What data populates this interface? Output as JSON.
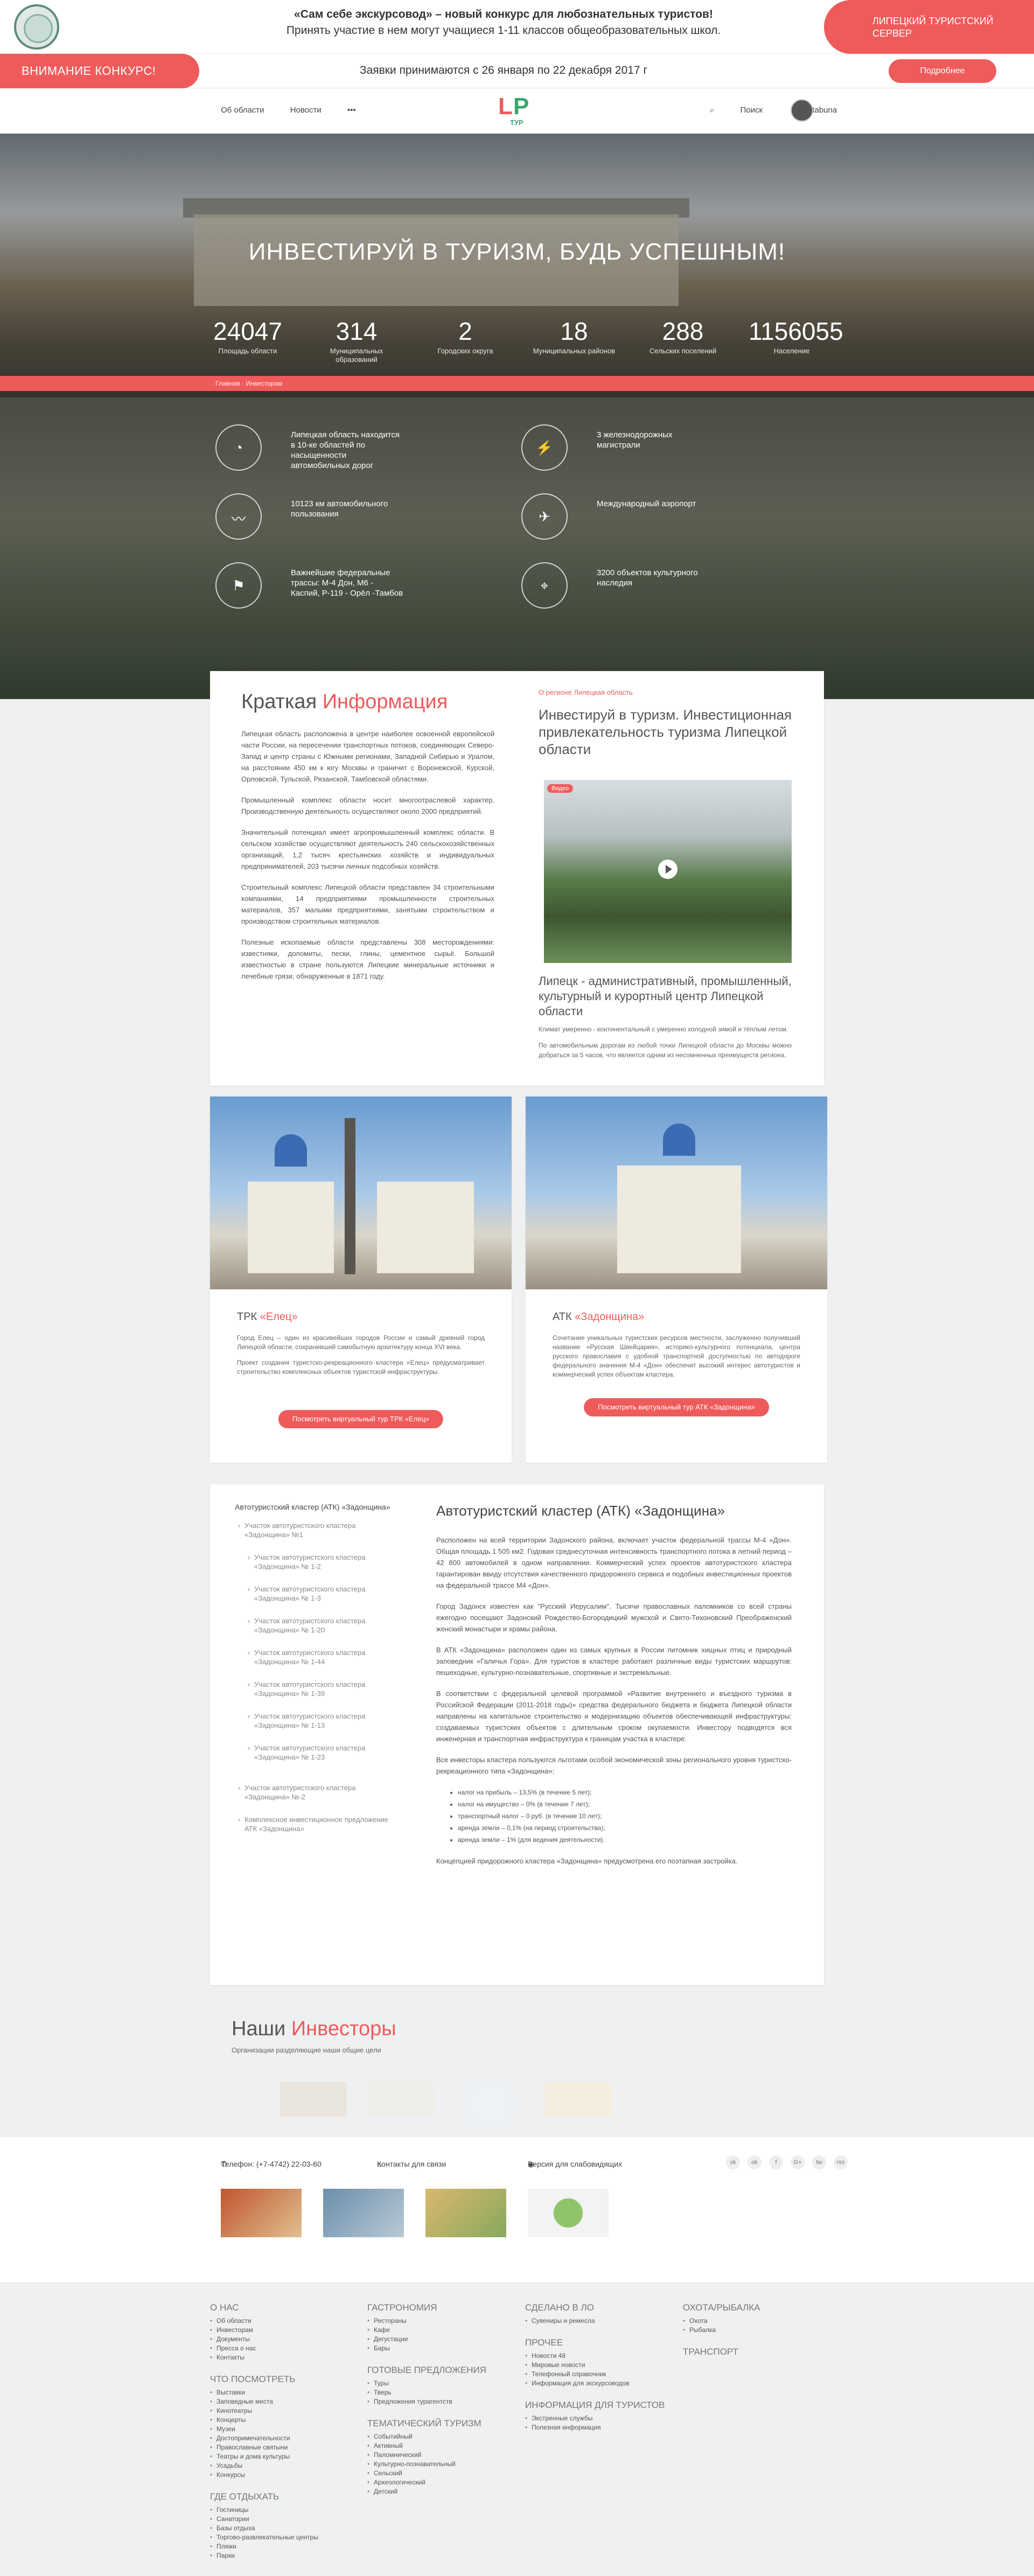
{
  "topbar": {
    "line1": "«Сам себе экскурсовод» – новый конкурс для любознательных туристов!",
    "line2": "Принять участие в нем могут учащиеся 1-11 классов общеобразовательных школ.",
    "server": "ЛИПЕЦКИЙ ТУРИСТСКИЙ СЕРВЕР"
  },
  "attention": {
    "label": "ВНИМАНИЕ КОНКУРС!",
    "text": "Заявки принимаются с 26 января по 22 декабря 2017 г",
    "button": "Подробнее"
  },
  "nav": {
    "links": [
      "Об области",
      "Новости",
      "•••"
    ],
    "search": "Поиск",
    "user": "tabuna",
    "brand": {
      "l": "L",
      "p": "P",
      "t": "ТУР"
    }
  },
  "hero": {
    "title": "ИНВЕСТИРУЙ В ТУРИЗМ, БУДЬ УСПЕШНЫМ!",
    "stats": [
      {
        "value": "24047",
        "label": "Площадь области"
      },
      {
        "value": "314",
        "label": "Муниципальных образований"
      },
      {
        "value": "2",
        "label": "Городских округа"
      },
      {
        "value": "18",
        "label": "Муниципальных районов"
      },
      {
        "value": "288",
        "label": "Сельских поселений"
      },
      {
        "value": "1156055",
        "label": "Население"
      }
    ],
    "breadcrumb": "Главная · Инвесторам"
  },
  "features": [
    {
      "icon": "◔",
      "text": "Липецкая область находится в 10-ке областей по насыщенности автомобильных дорог"
    },
    {
      "icon": "⚡",
      "text": "3 железнодорожных магистрали"
    },
    {
      "icon": "〰",
      "text": "10123 км автомобильного пользования"
    },
    {
      "icon": "✈",
      "text": "Международный аэропорт"
    },
    {
      "icon": "⚑",
      "text": "Важнейшие федеральные трассы: М-4 Дон, М6 - Каспий, Р-119 - Орёл -Тамбов"
    },
    {
      "icon": "⌖",
      "text": "3200 объектов культурного наследия"
    }
  ],
  "info": {
    "title_a": "Краткая ",
    "title_b": "Информация",
    "paragraphs": [
      "Липецкая область расположена в центре наиболее освоенной европейской части России, на пересечении транспортных потоков, соединяющих Северо-Запад и центр страны с Южными регионами, Западной Сибирью и Уралом, на расстоянии 450 км к югу Москвы и граничит с Воронежской, Курской, Орловской, Тульской, Рязанской, Тамбовской областями.",
      "Промышленный комплекс области носит многоотраслевой характер. Производственную деятельность осуществляют около 2000 предприятий.",
      "Значительный потенциал имеет агропромышленный комплекс области. В сельском хозяйстве осуществляют деятельность 240 сельскохозяйственных организаций, 1,2 тысяч крестьянских хозяйств и индивидуальных предпринимателей, 203 тысячи личных подсобных хозяйств.",
      "Строительный комплекс Липецкой области представлен 34 строительными компаниями, 14 предприятиями промышленности строительных материалов, 357 малыми предприятиями, занятыми строительством и производством строительных материалов.",
      "Полезные ископаемые области представлены 308 месторождениями: известняки, доломиты, пески, глины, цементное сырьё. Большой известностью в стране пользуются Липецкие минеральные источники и лечебные грязи, обнаруженные в 1871 году."
    ],
    "side_small": "О регионе Липецкая область",
    "side_title": "Инвестируй в туризм. Инвестиционная привлекательность туризма Липецкой области",
    "video_tag": "Видео",
    "caption": "Липецк - административный, промышленный, культурный и курортный центр Липецкой области",
    "side_paragraphs": [
      "Климат умеренно - континентальный с умеренно холодной зимой и тёплым летом.",
      "По автомобильным дорогам из любой точки Липецкой области до Москвы можно добраться за 5 часов, что является одним из несомненных преимуществ региона."
    ]
  },
  "tours": [
    {
      "prefix": "ТРК ",
      "name": "«Елец»",
      "paragraphs": [
        "Город Елец – один из красивейших городов России и самый древний город Липецкой области, сохранивший самобытную архитектуру конца XVI века.",
        "Проект создания туристско-рекреационного кластера «Елец» предусматривает строительство комплексных объектов туристской инфраструктуры."
      ],
      "button": "Посмотреть виртуальный тур ТРК «Елец»"
    },
    {
      "prefix": "АТК ",
      "name": "«Задонщина»",
      "paragraphs": [
        "Сочетание уникальных туристских ресурсов местности, заслуженно получивший название «Русская Швейцария», историко-культурного потенциала, центра русского православия с удобной транспортной доступностью по автодороге федерального значения М-4 «Дон» обеспечит высокий интерес автотуристов и коммерческий успех объектам кластера."
      ],
      "button": "Посмотреть виртуальный тур АТК «Задонщина»"
    }
  ],
  "atk": {
    "side_head": "Автотуристский кластер (АТК) «Задонщина»",
    "side_items": [
      {
        "text": "Участок автотуристского кластера «Задонщина» №1",
        "sub": false
      },
      {
        "text": "Участок автотуристского кластера «Задонщина» № 1-2",
        "sub": true
      },
      {
        "text": "Участок автотуристского кластера «Задонщина» № 1-3",
        "sub": true
      },
      {
        "text": "Участок автотуристского кластера «Задонщина» № 1-20",
        "sub": true
      },
      {
        "text": "Участок автотуристского кластера «Задонщина» № 1-44",
        "sub": true
      },
      {
        "text": "Участок автотуристского кластера «Задонщина» № 1-39",
        "sub": true
      },
      {
        "text": "Участок автотуристского кластера «Задонщина» № 1-13",
        "sub": true
      },
      {
        "text": "Участок автотуристского кластера «Задонщина» № 1-23",
        "sub": true
      },
      {
        "text": "Участок автотуристского кластера «Задонщина» №-2",
        "sub": false
      },
      {
        "text": "Комплексное инвестиционное предложение АТК «Задонщина»",
        "sub": false
      }
    ],
    "title": "Автотуристский кластер (АТК) «Задонщина»",
    "paragraphs": [
      "Расположен на всей территории Задонского района, включает участок федеральной трассы М-4 «Дон». Общая площадь 1 505 км2. Годовая среднесуточная интенсивность транспортного потока в летний период – 42 800 автомобилей в одном направлении. Коммерческий успех проектов автотуристского кластера гарантирован ввиду отсутствия качественного придорожного сервиса и подобных инвестиционных проектов на федеральной трассе М4 «Дон».",
      "Город Задонск известен как \"Русский Иерусалим\". Тысячи православных паломников со всей страны ежегодно посещают Задонский Рождество-Богородицкий мужской и Свято-Тихоновский Преображенский женский монастыри и храмы района.",
      "В АТК «Задонщина» расположен один из самых крупных в России питомник хищных птиц и природный заповедник «Галичья Гора». Для туристов в кластере работают различные виды туристских маршрутов: пешеходные, культурно-познавательные, спортивные и экстремальные.",
      "В соответствии с федеральной целевой программой «Развитие внутреннего и въездного туризма в Российской Федерации (2011-2018 годы)» средства федерального бюджета и бюджета Липецкой области направлены на капитальное строительство и модернизацию объектов обеспечивающей инфраструктуры: создаваемых туристских объектов с длительным сроком окупаемости. Инвестору подводятся вся инженерная и транспортная инфраструктура к границам участка в кластере.",
      "Все инвесторы кластера пользуются льготами особой экономической зоны регионального уровня туристско-рекреационного типа «Задонщина»:"
    ],
    "list": [
      "налог на прибыль – 13,5% (в течение 5 лет);",
      "налог на имущество – 0% (в течение 7 лет);",
      "транспортный налог – 0 руб. (в течение 10 лет);",
      "аренда земли – 0,1% (на период строительства);",
      "аренда земли – 1% (для ведения деятельности)."
    ],
    "footer": "Концепцией придорожного кластера «Задонщина» предусмотрена его поэтапная застройка."
  },
  "investors": {
    "title_a": "Наши ",
    "title_b": "Инвесторы",
    "subtitle": "Организации разделяющие наши общие цели"
  },
  "contacts": {
    "phone": "Телефон: (+7-4742) 22-03-60",
    "contact": "Контакты для связи",
    "vision": "Версия для слабовидящих",
    "social": [
      "vk",
      "ok",
      "f",
      "G+",
      "tw",
      "rss"
    ]
  },
  "footer": {
    "columns": [
      [
        {
          "head": "О НАС",
          "items": [
            "Об области",
            "Инвесторам",
            "Документы",
            "Пресса о нас",
            "Контакты"
          ]
        },
        {
          "head": "ЧТО ПОСМОТРЕТЬ",
          "items": [
            "Выставки",
            "Заповедные места",
            "Кинотеатры",
            "Концерты",
            "Музеи",
            "Достопримечательности",
            "Православные святыни",
            "Театры и дома культуры",
            "Усадьбы",
            "Конкурсы"
          ]
        },
        {
          "head": "ГДЕ ОТДЫХАТЬ",
          "items": [
            "Гостиницы",
            "Санатории",
            "Базы отдыха",
            "Торгово-развлекательные центры",
            "Пляжи",
            "Парки"
          ]
        }
      ],
      [
        {
          "head": "ГАСТРОНОМИЯ",
          "items": [
            "Рестораны",
            "Кафе",
            "Дегустации",
            "Бары"
          ]
        },
        {
          "head": "ГОТОВЫЕ ПРЕДЛОЖЕНИЯ",
          "items": [
            "Туры",
            "Тверь",
            "Предложения турагентств"
          ]
        },
        {
          "head": "ТЕМАТИЧЕСКИЙ ТУРИЗМ",
          "items": [
            "Событийный",
            "Активный",
            "Паломнический",
            "Культурно-познавательный",
            "Сельский",
            "Археологический",
            "Детский"
          ]
        }
      ],
      [
        {
          "head": "СДЕЛАНО В ЛО",
          "items": [
            "Сувениры и ремесла"
          ]
        },
        {
          "head": "ПРОЧЕЕ",
          "items": [
            "Новости 48",
            "Мировые новости",
            "Телефонный справочник",
            "Информация для экскурсоводов"
          ]
        },
        {
          "head": "ИНФОРМАЦИЯ ДЛЯ ТУРИСТОВ",
          "items": [
            "Экстренные службы",
            "Полезная информация"
          ]
        }
      ],
      [
        {
          "head": "ОХОТА/РЫБАЛКА",
          "items": [
            "Охота",
            "Рыбалка"
          ]
        },
        {
          "head": "ТРАНСПОРТ",
          "items": []
        }
      ]
    ]
  }
}
